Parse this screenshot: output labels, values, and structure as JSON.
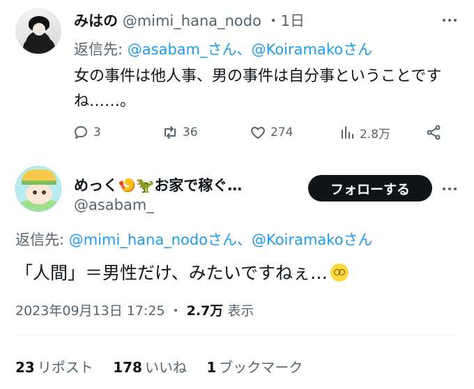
{
  "tweet1": {
    "display_name": "みはの",
    "handle": "@mimi_hana_nodo",
    "time": "・1日",
    "reply_prefix": "返信先:",
    "reply_mentions": "@asabam_さん、@Koiramakoさん",
    "text": "女の事件は他人事、男の事件は自分事ということですね……。",
    "replies": "3",
    "reposts": "36",
    "likes": "274",
    "views": "2.8万"
  },
  "tweet2": {
    "display_name": "めっく",
    "display_name_suffix": "お家で稼ぐ…",
    "handle": "@asabam_",
    "follow_label": "フォローする",
    "reply_prefix": "返信先:",
    "reply_mentions": "@mimi_hana_nodoさん、@Koiramakoさん",
    "text": "「人間」＝男性だけ、みたいですねぇ…",
    "timestamp": "2023年09月13日 17:25",
    "separator": "・",
    "views_count": "2.7万",
    "views_label": "表示",
    "reposts_count": "23",
    "reposts_label": "リポスト",
    "likes_count": "178",
    "likes_label": "いいね",
    "bookmarks_count": "1",
    "bookmarks_label": "ブックマーク"
  },
  "icons": [
    "more-icon",
    "reply-icon",
    "repost-icon",
    "like-icon",
    "views-icon",
    "share-icon",
    "shrimp-emoji",
    "dinosaur-emoji",
    "dizzy-face-emoji"
  ],
  "colors": {
    "link": "#1d9bf0",
    "secondary_text": "#536471",
    "primary_text": "#0f1419",
    "follow_button": "#0f1419"
  }
}
